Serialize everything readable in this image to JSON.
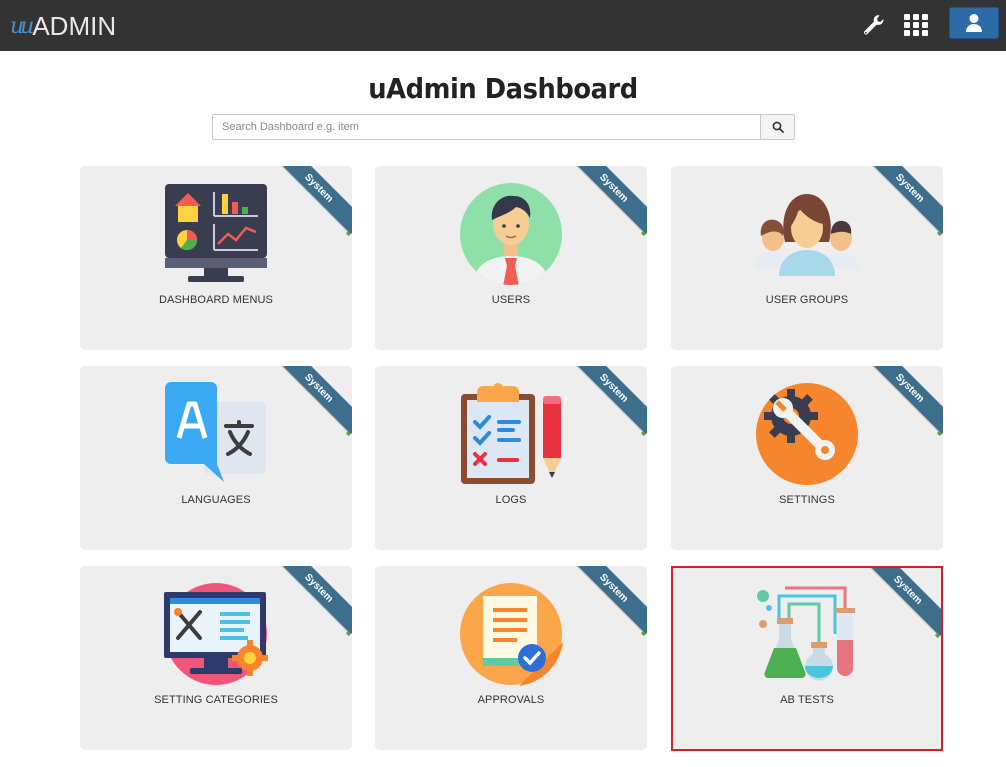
{
  "brand": {
    "prefix": "u",
    "name": "ADMIN"
  },
  "navbar": {
    "tool_icon": "wrench-icon",
    "apps_icon": "grid-icon",
    "user_icon": "user-icon",
    "bg_color": "#333333",
    "user_btn_color": "#2d6aa8"
  },
  "page": {
    "title": "uAdmin Dashboard"
  },
  "search": {
    "placeholder": "Search Dashboard e.g. item",
    "value": "",
    "button_icon": "search-icon"
  },
  "ribbon_label": "System",
  "cards": [
    {
      "label": "DASHBOARD MENUS",
      "icon": "dashboard-monitor-icon",
      "ribbon": "System",
      "selected": false
    },
    {
      "label": "USERS",
      "icon": "user-avatar-icon",
      "ribbon": "System",
      "selected": false
    },
    {
      "label": "USER GROUPS",
      "icon": "user-group-icon",
      "ribbon": "System",
      "selected": false
    },
    {
      "label": "LANGUAGES",
      "icon": "language-translate-icon",
      "ribbon": "System",
      "selected": false
    },
    {
      "label": "LOGS",
      "icon": "clipboard-log-icon",
      "ribbon": "System",
      "selected": false
    },
    {
      "label": "SETTINGS",
      "icon": "settings-gear-wrench-icon",
      "ribbon": "System",
      "selected": false
    },
    {
      "label": "SETTING CATEGORIES",
      "icon": "setting-categories-monitor-icon",
      "ribbon": "System",
      "selected": false
    },
    {
      "label": "APPROVALS",
      "icon": "approval-document-icon",
      "ribbon": "System",
      "selected": false
    },
    {
      "label": "AB TESTS",
      "icon": "lab-flask-icon",
      "ribbon": "System",
      "selected": true
    }
  ],
  "colors": {
    "card_bg": "#eeeeee",
    "ribbon": "#3d6f8c",
    "selected_border": "#d61f2c"
  }
}
